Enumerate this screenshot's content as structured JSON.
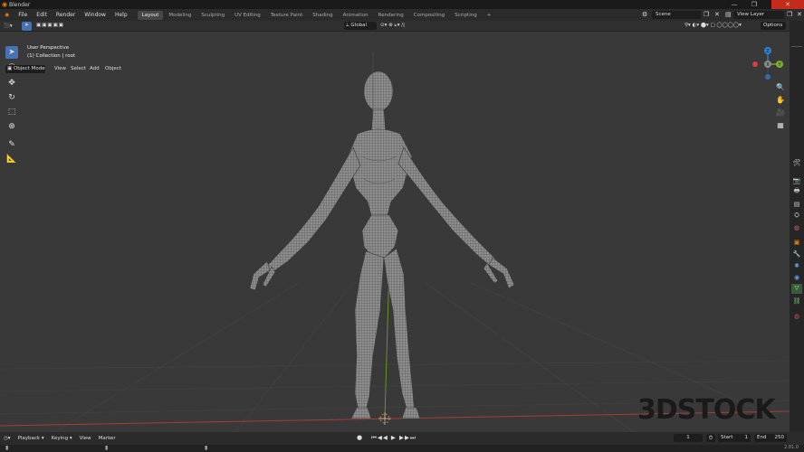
{
  "window": {
    "title": "Blender",
    "logo_icon": "blender-logo-icon"
  },
  "menu": {
    "items": [
      "File",
      "Edit",
      "Render",
      "Window",
      "Help"
    ],
    "workspaces": [
      "Layout",
      "Modeling",
      "Sculpting",
      "UV Editing",
      "Texture Paint",
      "Shading",
      "Animation",
      "Rendering",
      "Compositing",
      "Scripting"
    ],
    "active_workspace": "Layout",
    "add_tab": "+",
    "scene": "Scene",
    "view_layer": "View Layer"
  },
  "header": {
    "mode": "Object Mode",
    "menus": [
      "View",
      "Select",
      "Add",
      "Object"
    ],
    "transform_orientation": "Global",
    "options": "Options"
  },
  "viewport": {
    "perspective_label": "User Perspective",
    "collection_label": "(1) Collection | root",
    "gizmo": {
      "x": "X",
      "y": "Y",
      "z": "Z"
    },
    "watermark": "3DSTOCK"
  },
  "timeline": {
    "menus": [
      "Playback",
      "Keying",
      "View",
      "Marker"
    ],
    "current_frame": "1",
    "start_label": "Start",
    "start": "1",
    "end_label": "End",
    "end": "250"
  },
  "status": {
    "version": "2.81.0"
  },
  "colors": {
    "accent": "#4772b3",
    "x_axis": "#d93e3e",
    "y_axis": "#77b02a",
    "z_axis": "#2f7fd6",
    "blender_orange": "#e87d0d"
  }
}
